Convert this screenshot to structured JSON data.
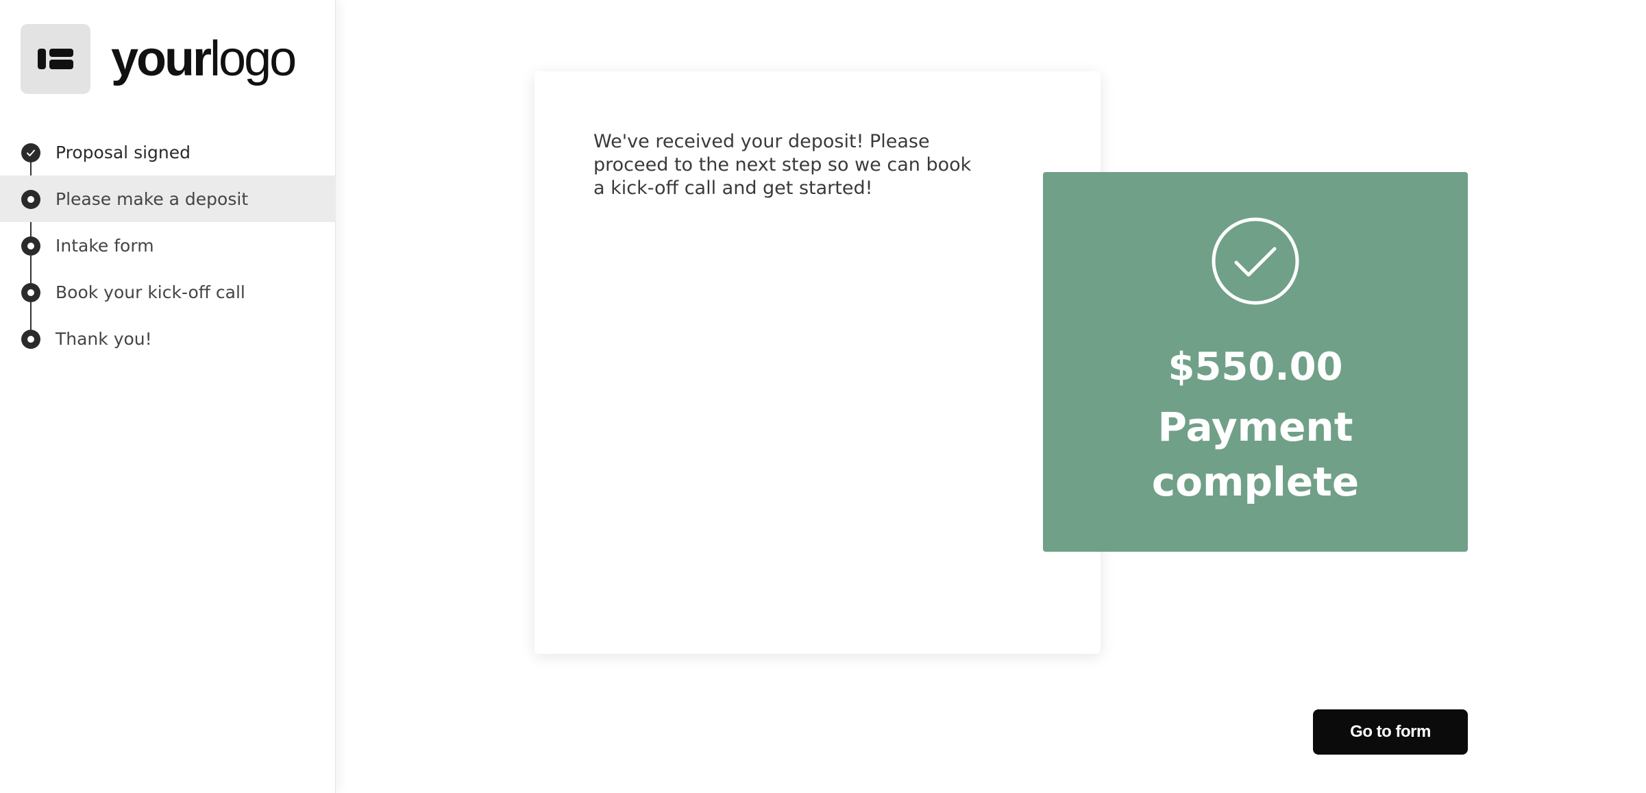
{
  "brand": {
    "logo_bold": "your",
    "logo_light": "logo",
    "logo_icon": "id-card-icon"
  },
  "sidebar": {
    "steps": [
      {
        "label": "Proposal signed",
        "status": "completed",
        "icon": "check-icon"
      },
      {
        "label": "Please make a deposit",
        "status": "current",
        "icon": "dot-icon"
      },
      {
        "label": "Intake form",
        "status": "pending",
        "icon": "dot-icon"
      },
      {
        "label": "Book your kick-off call",
        "status": "pending",
        "icon": "dot-icon"
      },
      {
        "label": "Thank you!",
        "status": "pending",
        "icon": "dot-icon"
      }
    ]
  },
  "main": {
    "message": "We've received your deposit! Please proceed to the next step so we can book a kick-off call and get started!",
    "payment": {
      "amount": "$550.00",
      "status": "Payment complete",
      "icon": "check-circle-icon",
      "color": "#70a088"
    },
    "button_label": "Go to form"
  },
  "colors": {
    "accent": "#70a088",
    "button": "#0b0b0b",
    "active_step_bg": "#ebebeb"
  }
}
